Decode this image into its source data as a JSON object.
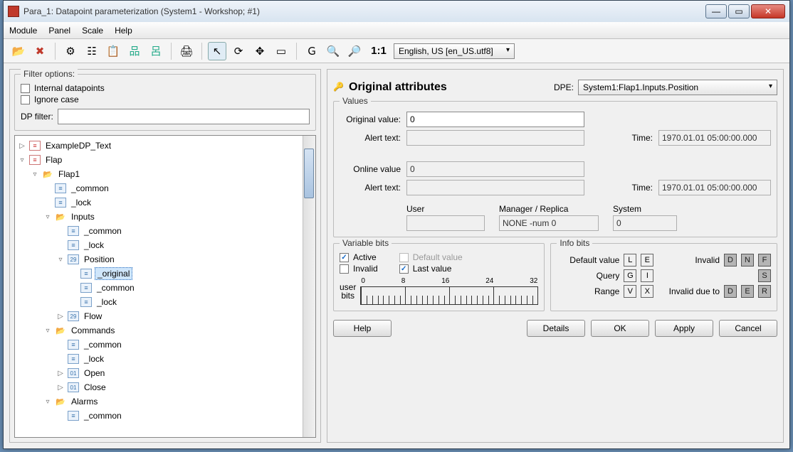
{
  "window": {
    "title": "Para_1: Datapoint parameterization (System1 - Workshop; #1)"
  },
  "menu": {
    "items": [
      "Module",
      "Panel",
      "Scale",
      "Help"
    ]
  },
  "toolbar": {
    "lang_label": "English, US [en_US.utf8]",
    "ratio": "1:1"
  },
  "filter": {
    "legend": "Filter options:",
    "internal_dp": "Internal datapoints",
    "ignore_case": "Ignore case",
    "dp_filter_label": "DP filter:",
    "dp_filter_value": ""
  },
  "tree": {
    "items": [
      {
        "lvl": 0,
        "exp": "▷",
        "ico": "struct",
        "label": "ExampleDP_Text"
      },
      {
        "lvl": 0,
        "exp": "▿",
        "ico": "struct",
        "label": "Flap"
      },
      {
        "lvl": 1,
        "exp": "▿",
        "ico": "folderopen",
        "label": "Flap1"
      },
      {
        "lvl": 2,
        "exp": "",
        "ico": "leaf",
        "label": "_common"
      },
      {
        "lvl": 2,
        "exp": "",
        "ico": "leaf",
        "label": "_lock"
      },
      {
        "lvl": 2,
        "exp": "▿",
        "ico": "folderopen",
        "label": "Inputs"
      },
      {
        "lvl": 3,
        "exp": "",
        "ico": "leaf",
        "label": "_common"
      },
      {
        "lvl": 3,
        "exp": "",
        "ico": "leaf",
        "label": "_lock"
      },
      {
        "lvl": 3,
        "exp": "▿",
        "ico": "num",
        "num": "29",
        "label": "Position"
      },
      {
        "lvl": 4,
        "exp": "",
        "ico": "leaf",
        "label": "_original",
        "selected": true
      },
      {
        "lvl": 4,
        "exp": "",
        "ico": "leaf",
        "label": "_common"
      },
      {
        "lvl": 4,
        "exp": "",
        "ico": "leaf",
        "label": "_lock"
      },
      {
        "lvl": 3,
        "exp": "▷",
        "ico": "num",
        "num": "29",
        "label": "Flow"
      },
      {
        "lvl": 2,
        "exp": "▿",
        "ico": "folderopen",
        "label": "Commands"
      },
      {
        "lvl": 3,
        "exp": "",
        "ico": "leaf",
        "label": "_common"
      },
      {
        "lvl": 3,
        "exp": "",
        "ico": "leaf",
        "label": "_lock"
      },
      {
        "lvl": 3,
        "exp": "▷",
        "ico": "bool",
        "num": "01",
        "label": "Open"
      },
      {
        "lvl": 3,
        "exp": "▷",
        "ico": "bool",
        "num": "01",
        "label": "Close"
      },
      {
        "lvl": 2,
        "exp": "▿",
        "ico": "folderopen",
        "label": "Alarms"
      },
      {
        "lvl": 3,
        "exp": "",
        "ico": "leaf",
        "label": "_common"
      }
    ]
  },
  "attr": {
    "title": "Original attributes",
    "dpe_label": "DPE:",
    "dpe_value": "System1:Flap1.Inputs.Position",
    "values_legend": "Values",
    "orig_value_label": "Original value:",
    "orig_value": "0",
    "alert_text_label": "Alert text:",
    "orig_alert": "",
    "time_label": "Time:",
    "orig_time": "1970.01.01 05:00:00.000",
    "online_value_label": "Online value",
    "online_value": "0",
    "online_alert": "",
    "online_time": "1970.01.01 05:00:00.000",
    "user_label": "User",
    "user_value": "",
    "mgr_label": "Manager / Replica",
    "mgr_value": "NONE -num 0",
    "system_label": "System",
    "system_value": "0"
  },
  "varbits": {
    "legend": "Variable bits",
    "active": "Active",
    "invalid": "Invalid",
    "default_value": "Default value",
    "last_value": "Last value",
    "user_bits_label1": "user",
    "user_bits_label2": "bits",
    "scale": [
      "0",
      "8",
      "16",
      "24",
      "32"
    ]
  },
  "infobits": {
    "legend": "Info bits",
    "default_value_label": "Default value",
    "query_label": "Query",
    "range_label": "Range",
    "invalid_label": "Invalid",
    "invalid_due_label": "Invalid due to"
  },
  "buttons": {
    "help": "Help",
    "details": "Details",
    "ok": "OK",
    "apply": "Apply",
    "cancel": "Cancel"
  }
}
